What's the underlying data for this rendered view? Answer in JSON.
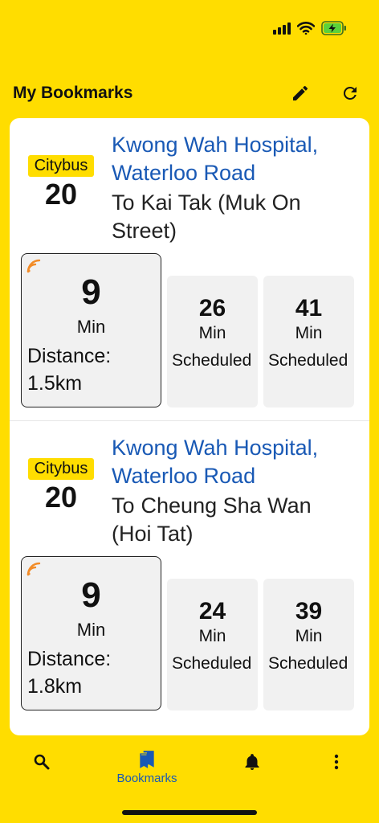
{
  "header": {
    "title": "My Bookmarks",
    "edit_icon": "pencil-icon",
    "refresh_icon": "refresh-icon"
  },
  "colors": {
    "brand_yellow": "#FFDD00",
    "link_blue": "#1959B5",
    "feed_orange": "#F28C28"
  },
  "bookmarks": [
    {
      "company": "Citybus",
      "route": "20",
      "stop": "Kwong Wah Hospital, Waterloo Road",
      "dest_prefix": "To",
      "destination": "Kai Tak (Muk On Street)",
      "eta_main": {
        "value": "9",
        "unit": "Min",
        "distance": "Distance: 1.5km"
      },
      "etas": [
        {
          "value": "26",
          "unit": "Min",
          "status": "Scheduled"
        },
        {
          "value": "41",
          "unit": "Min",
          "status": "Scheduled"
        }
      ]
    },
    {
      "company": "Citybus",
      "route": "20",
      "stop": "Kwong Wah Hospital, Waterloo Road",
      "dest_prefix": "To",
      "destination": "Cheung Sha Wan (Hoi Tat)",
      "eta_main": {
        "value": "9",
        "unit": "Min",
        "distance": "Distance: 1.8km"
      },
      "etas": [
        {
          "value": "24",
          "unit": "Min",
          "status": "Scheduled"
        },
        {
          "value": "39",
          "unit": "Min",
          "status": "Scheduled"
        }
      ]
    }
  ],
  "nav": {
    "items": [
      {
        "icon": "search-icon",
        "label": ""
      },
      {
        "icon": "bookmarks-icon",
        "label": "Bookmarks"
      },
      {
        "icon": "bell-icon",
        "label": ""
      },
      {
        "icon": "more-vertical-icon",
        "label": ""
      }
    ]
  }
}
